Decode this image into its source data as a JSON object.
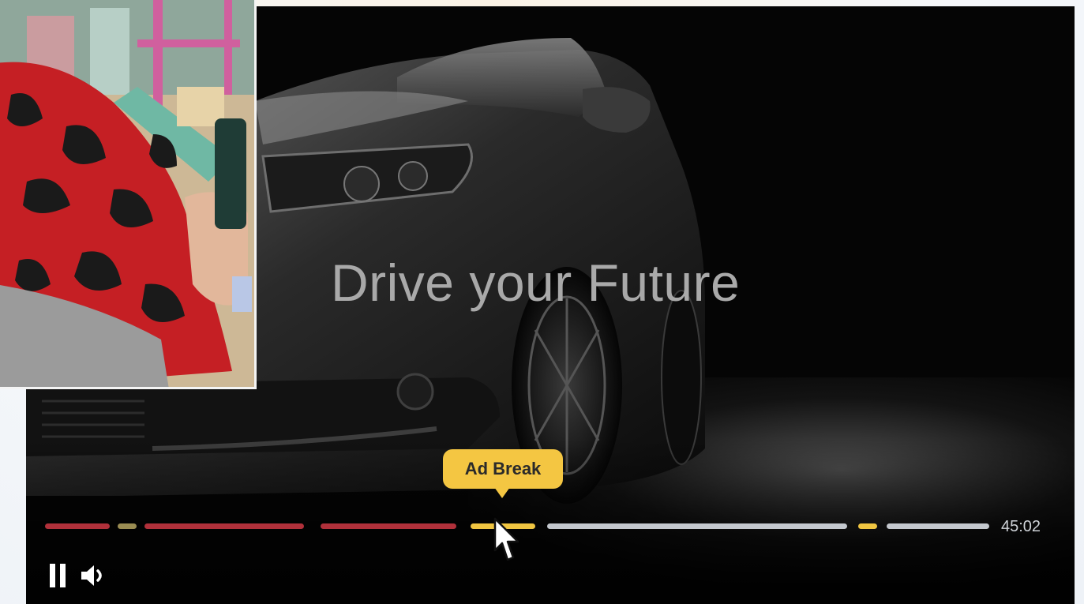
{
  "video": {
    "ad_headline": "Drive your Future",
    "tooltip": "Ad Break",
    "duration": "45:02",
    "progress_fraction": 0.44,
    "timeline_segments": [
      {
        "kind": "played"
      },
      {
        "kind": "ad-past"
      },
      {
        "kind": "played"
      },
      {
        "kind": "played"
      },
      {
        "kind": "ad-current"
      },
      {
        "kind": "unplayed"
      },
      {
        "kind": "ad-upcoming"
      },
      {
        "kind": "unplayed"
      }
    ]
  },
  "controls": {
    "pause_icon": "pause-icon",
    "volume_icon": "volume-icon"
  },
  "colors": {
    "played": "#b0303a",
    "unplayed": "#c4c8ce",
    "ad_marker": "#f0c541",
    "tooltip_bg": "#f4c642"
  }
}
